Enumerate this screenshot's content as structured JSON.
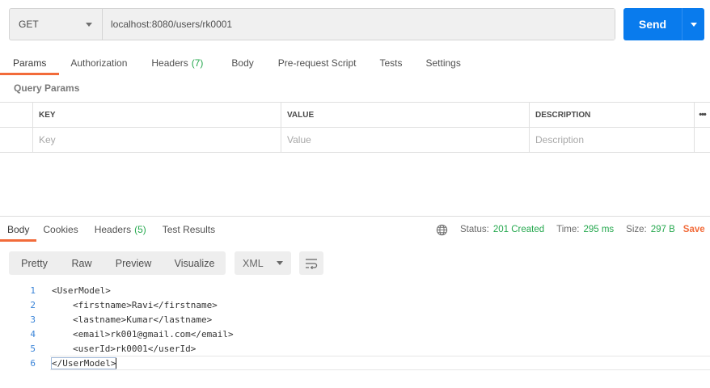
{
  "request": {
    "method": "GET",
    "url": "localhost:8080/users/rk0001",
    "send_label": "Send"
  },
  "request_tabs": [
    {
      "label": "Params",
      "count": ""
    },
    {
      "label": "Authorization",
      "count": ""
    },
    {
      "label": "Headers",
      "count": "(7)"
    },
    {
      "label": "Body",
      "count": ""
    },
    {
      "label": "Pre-request Script",
      "count": ""
    },
    {
      "label": "Tests",
      "count": ""
    },
    {
      "label": "Settings",
      "count": ""
    }
  ],
  "query_params": {
    "title": "Query Params",
    "columns": {
      "key": "KEY",
      "value": "VALUE",
      "description": "DESCRIPTION",
      "more": "•••"
    },
    "placeholders": {
      "key": "Key",
      "value": "Value",
      "description": "Description"
    }
  },
  "response_tabs": [
    {
      "label": "Body",
      "count": ""
    },
    {
      "label": "Cookies",
      "count": ""
    },
    {
      "label": "Headers",
      "count": "(5)"
    },
    {
      "label": "Test Results",
      "count": ""
    }
  ],
  "response_status": {
    "status_label": "Status:",
    "status_value": "201 Created",
    "time_label": "Time:",
    "time_value": "295 ms",
    "size_label": "Size:",
    "size_value": "297 B",
    "save_label": "Save"
  },
  "view_modes": [
    "Pretty",
    "Raw",
    "Preview",
    "Visualize"
  ],
  "format": "XML",
  "code_lines": [
    {
      "n": "1",
      "text": "<UserModel>"
    },
    {
      "n": "2",
      "text": "<firstname>Ravi</firstname>"
    },
    {
      "n": "3",
      "text": "<lastname>Kumar</lastname>"
    },
    {
      "n": "4",
      "text": "<email>rk001@gmail.com</email>"
    },
    {
      "n": "5",
      "text": "<userId>rk0001</userId>"
    },
    {
      "n": "6",
      "text": "</UserModel>"
    }
  ],
  "colors": {
    "accent": "#f26b3a",
    "primary": "#097bed",
    "success": "#25a84e"
  },
  "icons": [
    "chevron-down-icon",
    "globe-icon",
    "wrap-lines-icon"
  ]
}
